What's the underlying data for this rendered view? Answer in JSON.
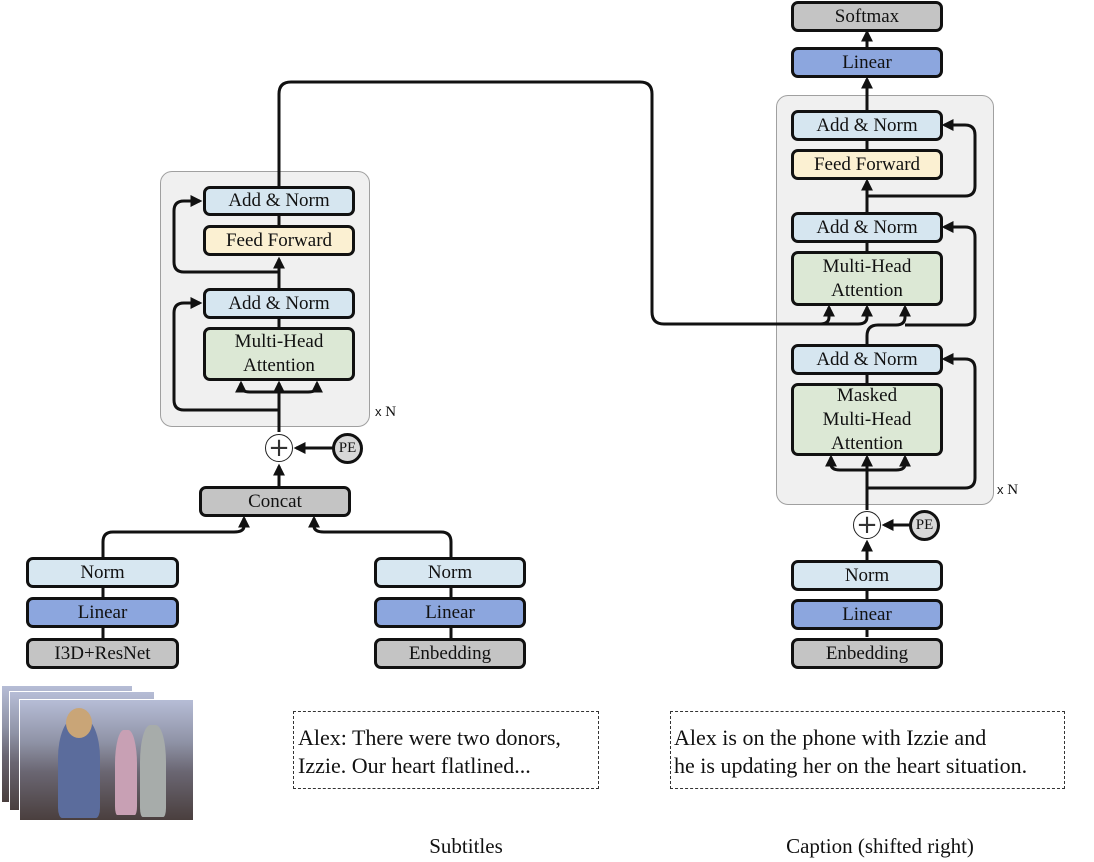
{
  "colors": {
    "add_norm": "#d6e6f0",
    "feed_forward": "#fbf0d2",
    "attention": "#dce8d5",
    "linear": "#8ca6de",
    "gray_block": "#c4c4c4",
    "norm": "#d7e7f1",
    "panel": "#f0f0f0"
  },
  "encoder": {
    "add_norm_top": "Add & Norm",
    "feed_forward": "Feed Forward",
    "add_norm_bottom": "Add & Norm",
    "attention": "Multi-Head Attention",
    "repeat": "N",
    "repeat_prefix": "x",
    "pe": "PE",
    "plus": "+",
    "concat": "Concat"
  },
  "video_branch": {
    "norm": "Norm",
    "linear": "Linear",
    "feature": "I3D+ResNet"
  },
  "subtitle_branch": {
    "norm": "Norm",
    "linear": "Linear",
    "embedding": "Enbedding",
    "text_line1": "Alex: There were two donors,",
    "text_line2": "Izzie. Our heart flatlined...",
    "label": "Subtitles"
  },
  "decoder": {
    "softmax": "Softmax",
    "linear_out": "Linear",
    "add_norm_1": "Add & Norm",
    "feed_forward": "Feed Forward",
    "add_norm_2": "Add & Norm",
    "cross_attention": "Multi-Head Attention",
    "add_norm_3": "Add & Norm",
    "masked_attention": "Masked Multi-Head Attention",
    "repeat": "N",
    "repeat_prefix": "x",
    "pe": "PE",
    "plus": "+",
    "norm": "Norm",
    "linear": "Linear",
    "embedding": "Enbedding",
    "text_line1": "Alex is on the phone with Izzie and",
    "text_line2": "he is updating her on the heart situation.",
    "label": "Caption (shifted right)"
  }
}
